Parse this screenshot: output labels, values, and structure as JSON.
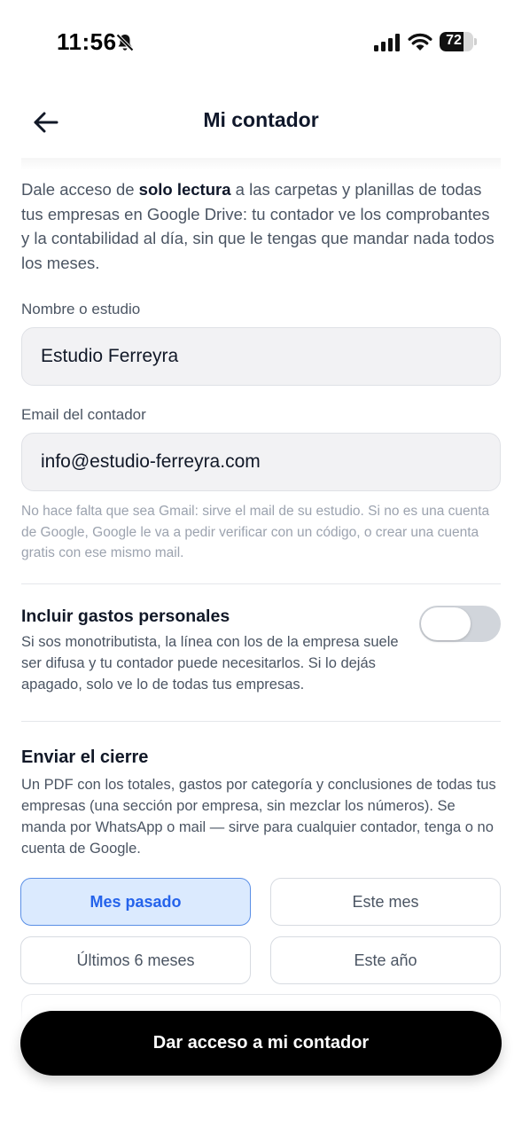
{
  "status_bar": {
    "time": "11:56",
    "battery_level": "72",
    "battery_fraction": 0.72,
    "icons": [
      "bell-slash-icon",
      "signal-icon",
      "wifi-icon",
      "battery-icon"
    ]
  },
  "header": {
    "title": "Mi contador",
    "back_icon": "arrow-left-icon"
  },
  "intro": {
    "before": "Dale acceso de ",
    "bold": "solo lectura",
    "after": " a las carpetas y planillas de todas tus empresas en Google Drive: tu contador ve los comprobantes y la contabilidad al día, sin que le tengas que mandar nada todos los meses."
  },
  "form": {
    "name_label": "Nombre o estudio",
    "name_value": "Estudio Ferreyra",
    "email_label": "Email del contador",
    "email_value": "info@estudio-ferreyra.com",
    "email_hint": "No hace falta que sea Gmail: sirve el mail de su estudio. Si no es una cuenta de Google, Google le va a pedir verificar con un código, o crear una cuenta gratis con ese mismo mail."
  },
  "personal_expenses": {
    "title": "Incluir gastos personales",
    "description": "Si sos monotributista, la línea con los de la empresa suele ser difusa y tu contador puede necesitarlos. Si lo dejás apagado, solo ve lo de todas tus empresas.",
    "enabled": false
  },
  "closing": {
    "title": "Enviar el cierre",
    "description": "Un PDF con los totales, gastos por categoría y conclusiones de todas tus empresas (una sección por empresa, sin mezclar los números). Se manda por WhatsApp o mail — sirve para cualquier contador, tenga o no cuenta de Google.",
    "options": [
      "Mes pasado",
      "Este mes",
      "Últimos 6 meses",
      "Este año"
    ],
    "selected": "Mes pasado"
  },
  "cta": {
    "label": "Dar acceso a mi contador"
  },
  "colors": {
    "accent": "#2563eb",
    "selected_bg": "#dbeafe",
    "cta_bg": "#000000"
  }
}
